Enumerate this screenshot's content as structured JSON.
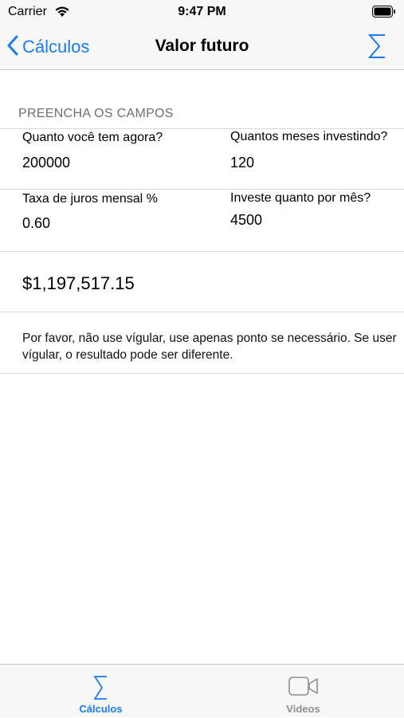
{
  "status_bar": {
    "carrier": "Carrier",
    "time": "9:47 PM"
  },
  "nav": {
    "back_label": "Cálculos",
    "title": "Valor futuro",
    "accent": "#1a7cf0"
  },
  "form": {
    "section_header": "PREENCHA OS CAMPOS",
    "fields": [
      {
        "label": "Quanto você tem agora?",
        "value": "200000"
      },
      {
        "label": "Quantos meses investindo?",
        "value": "120"
      },
      {
        "label": "Taxa de juros mensal %",
        "value": "0.60"
      },
      {
        "label": "Investe quanto por mês?",
        "value": "4500"
      }
    ],
    "result": "$1,197,517.15",
    "note": "Por favor, não use vígular, use apenas ponto se necessário. Se user vígular, o resultado pode ser diferente."
  },
  "tab_bar": {
    "tabs": [
      {
        "label": "Cálculos",
        "icon": "sigma-icon",
        "active": true,
        "color": "#1a7cf0"
      },
      {
        "label": "Videos",
        "icon": "video-camera-icon",
        "active": false,
        "color": "#8e8e93"
      }
    ]
  }
}
